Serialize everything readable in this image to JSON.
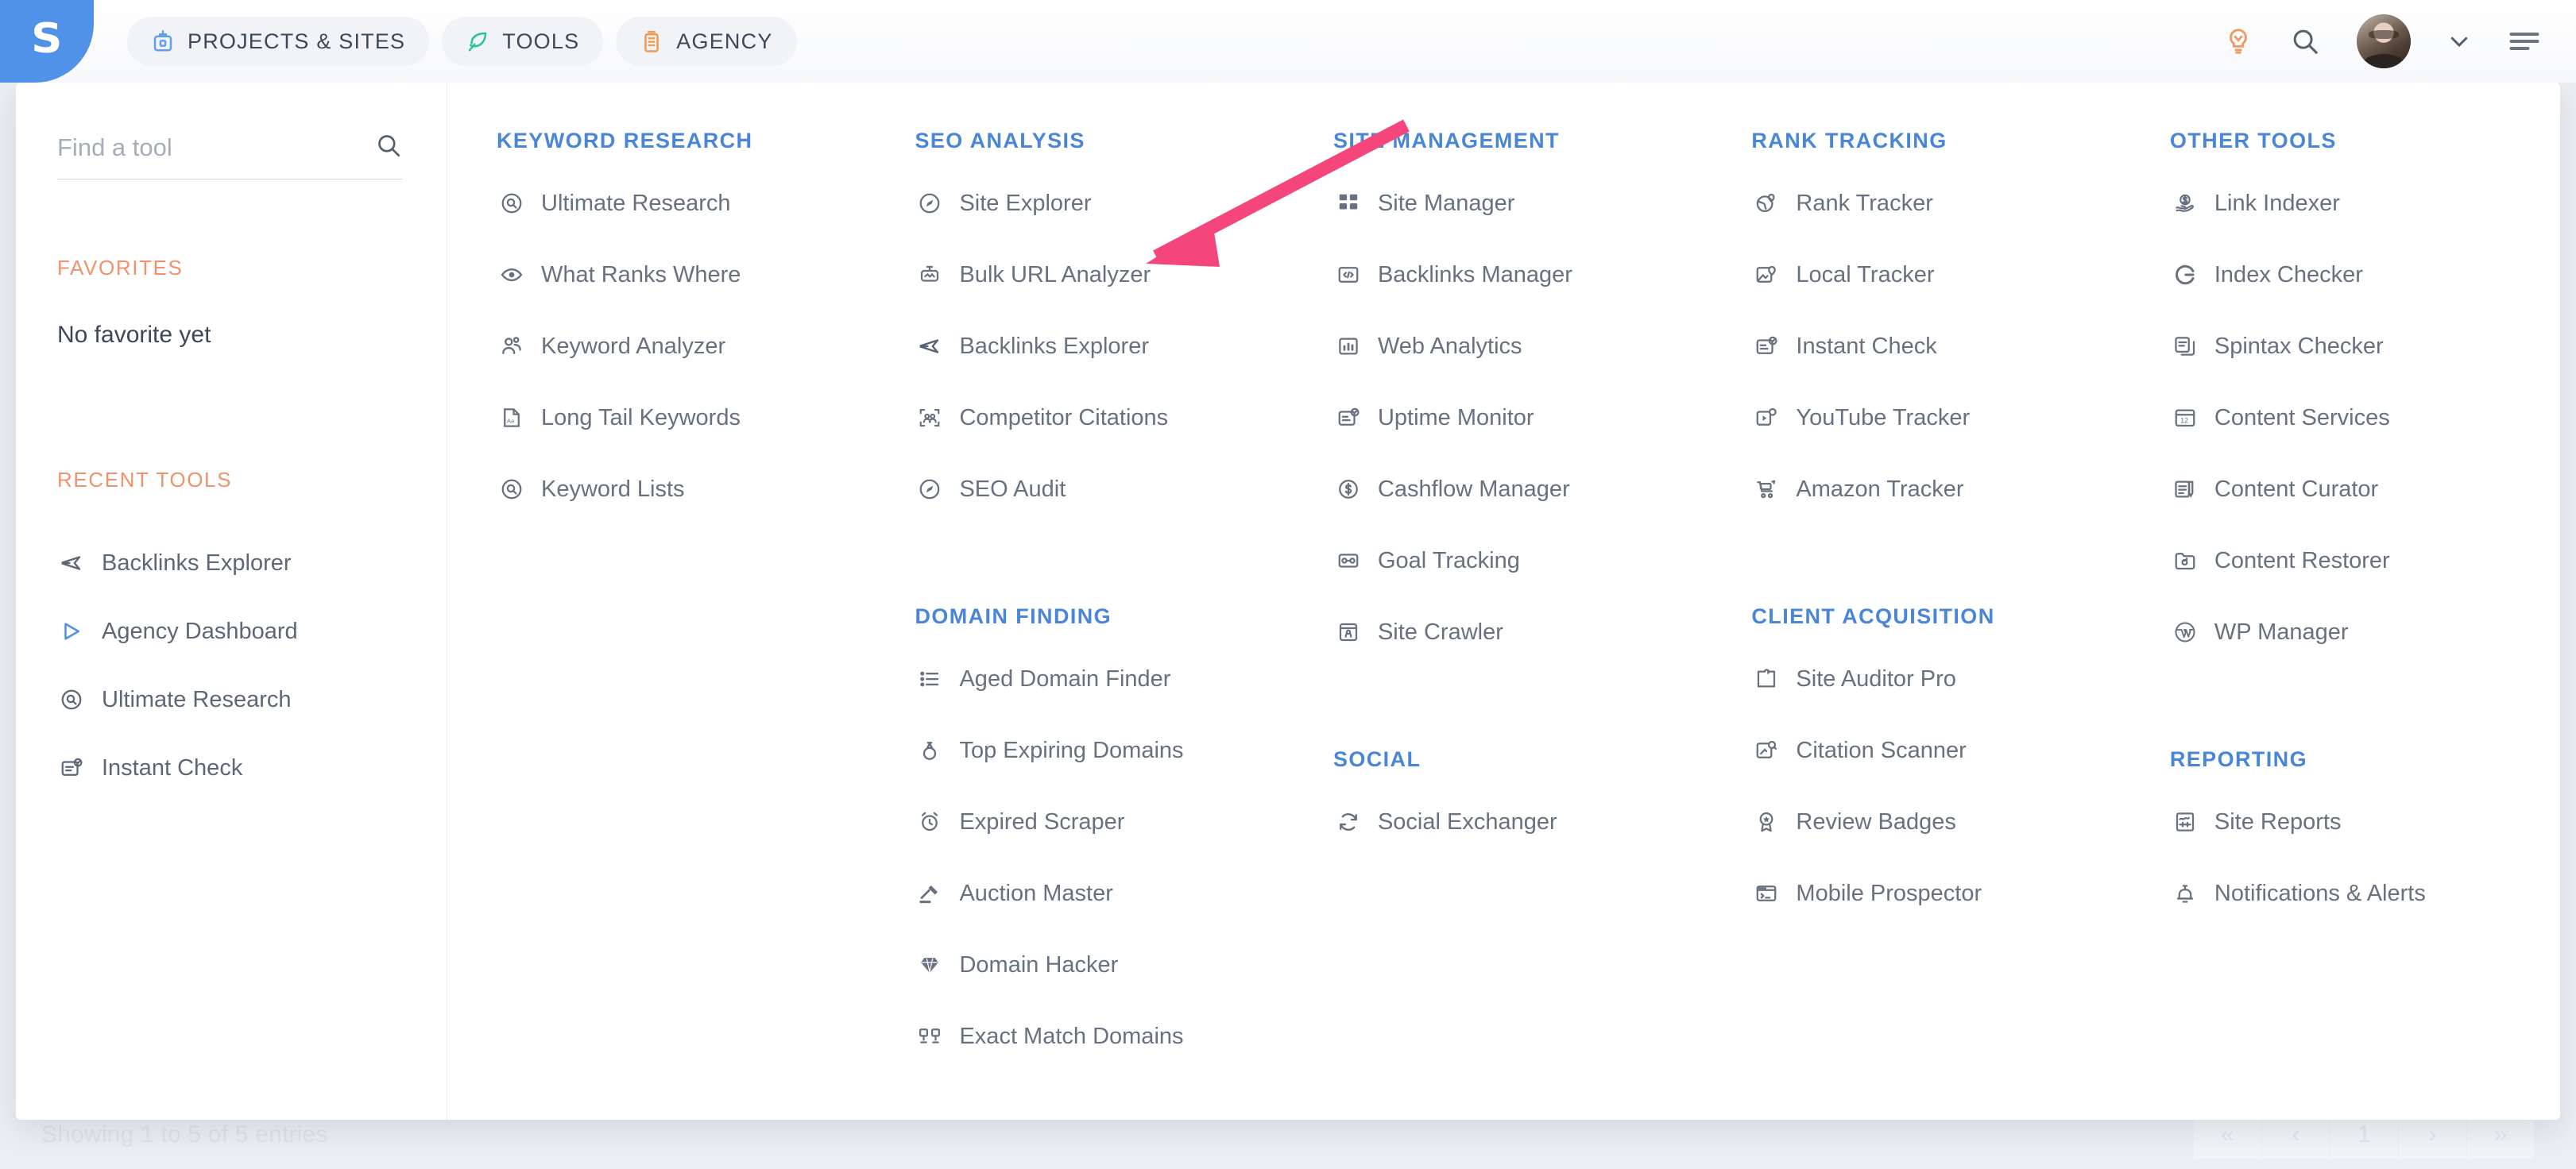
{
  "header": {
    "logo_letter": "S",
    "nav_pills": [
      {
        "label": "PROJECTS & SITES",
        "icon": "briefcase-icon",
        "color": "#63a0ea"
      },
      {
        "label": "TOOLS",
        "icon": "leaf-icon",
        "color": "#28c49a"
      },
      {
        "label": "AGENCY",
        "icon": "building-icon",
        "color": "#ef9a4a"
      }
    ],
    "icons": {
      "lightbulb": "lightbulb-icon",
      "search": "search-icon",
      "avatar": "avatar",
      "chevron": "chevron-down-icon",
      "menu": "hamburger-menu-icon"
    }
  },
  "sidebar": {
    "search_placeholder": "Find a tool",
    "search_value": "",
    "favorites_title": "FAVORITES",
    "favorites_empty": "No favorite yet",
    "recent_title": "RECENT TOOLS",
    "recent_items": [
      {
        "label": "Backlinks Explorer",
        "icon": "airplane-icon"
      },
      {
        "label": "Agency Dashboard",
        "icon": "play-triangle-icon"
      },
      {
        "label": "Ultimate Research",
        "icon": "magnifier-circle-icon"
      },
      {
        "label": "Instant Check",
        "icon": "document-check-icon"
      }
    ]
  },
  "columns": [
    {
      "groups": [
        {
          "title": "KEYWORD RESEARCH",
          "items": [
            {
              "label": "Ultimate Research",
              "icon": "magnifier-circle-icon"
            },
            {
              "label": "What Ranks Where",
              "icon": "eye-icon"
            },
            {
              "label": "Keyword Analyzer",
              "icon": "users-icon"
            },
            {
              "label": "Long Tail Keywords",
              "icon": "document-text-icon"
            },
            {
              "label": "Keyword Lists",
              "icon": "magnifier-circle-icon"
            }
          ]
        }
      ]
    },
    {
      "groups": [
        {
          "title": "SEO ANALYSIS",
          "items": [
            {
              "label": "Site Explorer",
              "icon": "compass-icon"
            },
            {
              "label": "Bulk URL Analyzer",
              "icon": "robot-icon"
            },
            {
              "label": "Backlinks Explorer",
              "icon": "airplane-icon"
            },
            {
              "label": "Competitor Citations",
              "icon": "people-frame-icon"
            },
            {
              "label": "SEO Audit",
              "icon": "compass-icon"
            }
          ]
        },
        {
          "title": "DOMAIN FINDING",
          "items": [
            {
              "label": "Aged Domain Finder",
              "icon": "list-icon"
            },
            {
              "label": "Top Expiring Domains",
              "icon": "ring-icon"
            },
            {
              "label": "Expired Scraper",
              "icon": "alarm-clock-icon"
            },
            {
              "label": "Auction Master",
              "icon": "gavel-icon"
            },
            {
              "label": "Domain Hacker",
              "icon": "diamond-icon"
            },
            {
              "label": "Exact Match Domains",
              "icon": "two-badges-icon"
            }
          ]
        }
      ]
    },
    {
      "groups": [
        {
          "title": "SITE MANAGEMENT",
          "items": [
            {
              "label": "Site Manager",
              "icon": "grid-squares-icon"
            },
            {
              "label": "Backlinks Manager",
              "icon": "code-window-icon"
            },
            {
              "label": "Web Analytics",
              "icon": "bar-chart-icon"
            },
            {
              "label": "Uptime Monitor",
              "icon": "monitor-check-icon"
            },
            {
              "label": "Cashflow Manager",
              "icon": "dollar-circle-icon"
            },
            {
              "label": "Goal Tracking",
              "icon": "goal-card-icon"
            },
            {
              "label": "Site Crawler",
              "icon": "crawler-window-icon"
            }
          ]
        },
        {
          "title": "SOCIAL",
          "items": [
            {
              "label": "Social Exchanger",
              "icon": "refresh-cycle-icon"
            }
          ]
        }
      ]
    },
    {
      "groups": [
        {
          "title": "RANK TRACKING",
          "items": [
            {
              "label": "Rank Tracker",
              "icon": "globe-pin-icon"
            },
            {
              "label": "Local Tracker",
              "icon": "map-pin-icon"
            },
            {
              "label": "Instant Check",
              "icon": "document-check-icon"
            },
            {
              "label": "YouTube Tracker",
              "icon": "video-pin-icon"
            },
            {
              "label": "Amazon Tracker",
              "icon": "shopping-cart-icon"
            }
          ]
        },
        {
          "title": "CLIENT ACQUISITION",
          "items": [
            {
              "label": "Site Auditor Pro",
              "icon": "puzzle-icon"
            },
            {
              "label": "Citation Scanner",
              "icon": "scan-doc-icon"
            },
            {
              "label": "Review Badges",
              "icon": "award-ribbon-icon"
            },
            {
              "label": "Mobile Prospector",
              "icon": "terminal-window-icon"
            }
          ]
        }
      ]
    },
    {
      "groups": [
        {
          "title": "OTHER TOOLS",
          "items": [
            {
              "label": "Link Indexer",
              "icon": "hand-coin-icon"
            },
            {
              "label": "Index Checker",
              "icon": "google-g-icon"
            },
            {
              "label": "Spintax Checker",
              "icon": "copy-docs-icon"
            },
            {
              "label": "Content Services",
              "icon": "calendar-12-icon"
            },
            {
              "label": "Content Curator",
              "icon": "doc-pen-icon"
            },
            {
              "label": "Content Restorer",
              "icon": "folder-restore-icon"
            },
            {
              "label": "WP Manager",
              "icon": "wordpress-icon"
            }
          ]
        },
        {
          "title": "REPORTING",
          "items": [
            {
              "label": "Site Reports",
              "icon": "report-sliders-icon"
            },
            {
              "label": "Notifications & Alerts",
              "icon": "bell-icon"
            }
          ]
        }
      ]
    }
  ],
  "background": {
    "entries_text": "Showing 1 to 5 of 5 entries",
    "pager": [
      "«",
      "‹",
      "1",
      "›",
      "»"
    ]
  },
  "annotation": {
    "arrow_color": "#f5467c",
    "points_to": "Backlinks Explorer"
  }
}
